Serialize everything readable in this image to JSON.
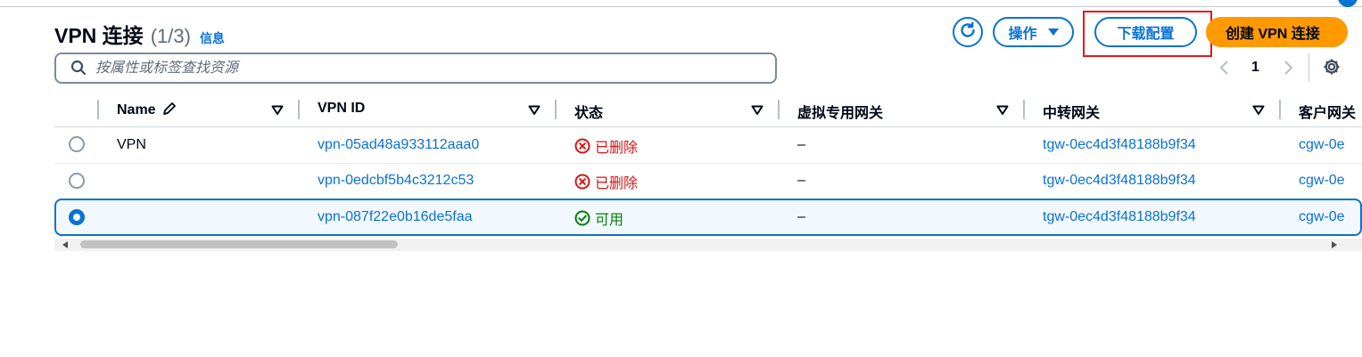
{
  "header": {
    "title": "VPN 连接",
    "count": "(1/3)",
    "info_link": "信息"
  },
  "toolbar": {
    "refresh_icon": "refresh-icon",
    "actions_label": "操作",
    "download_label": "下载配置",
    "create_label": "创建 VPN 连接"
  },
  "search": {
    "placeholder": "按属性或标签查找资源",
    "value": ""
  },
  "pagination": {
    "current_page": "1"
  },
  "table": {
    "columns": {
      "name": "Name",
      "vpn_id": "VPN ID",
      "state": "状态",
      "vgw": "虚拟专用网关",
      "tgw": "中转网关",
      "cgw": "客户网关"
    },
    "rows": [
      {
        "name": "VPN",
        "vpn_id": "vpn-05ad48a933112aaa0",
        "state": "已删除",
        "vgw": "–",
        "tgw": "tgw-0ec4d3f48188b9f34",
        "cgw": "cgw-0e",
        "selected": false
      },
      {
        "name": "",
        "vpn_id": "vpn-0edcbf5b4c3212c53",
        "state": "已删除",
        "vgw": "–",
        "tgw": "tgw-0ec4d3f48188b9f34",
        "cgw": "cgw-0e",
        "selected": false
      },
      {
        "name": "",
        "vpn_id": "vpn-087f22e0b16de5faa",
        "state": "可用",
        "vgw": "–",
        "tgw": "tgw-0ec4d3f48188b9f34",
        "cgw": "cgw-0e",
        "selected": true
      }
    ]
  },
  "colors": {
    "accent": "#0972d3",
    "primary_button": "#ff9900",
    "status_deleted": "#d91515",
    "status_available": "#037f0c",
    "highlight_box": "#e8161b"
  }
}
